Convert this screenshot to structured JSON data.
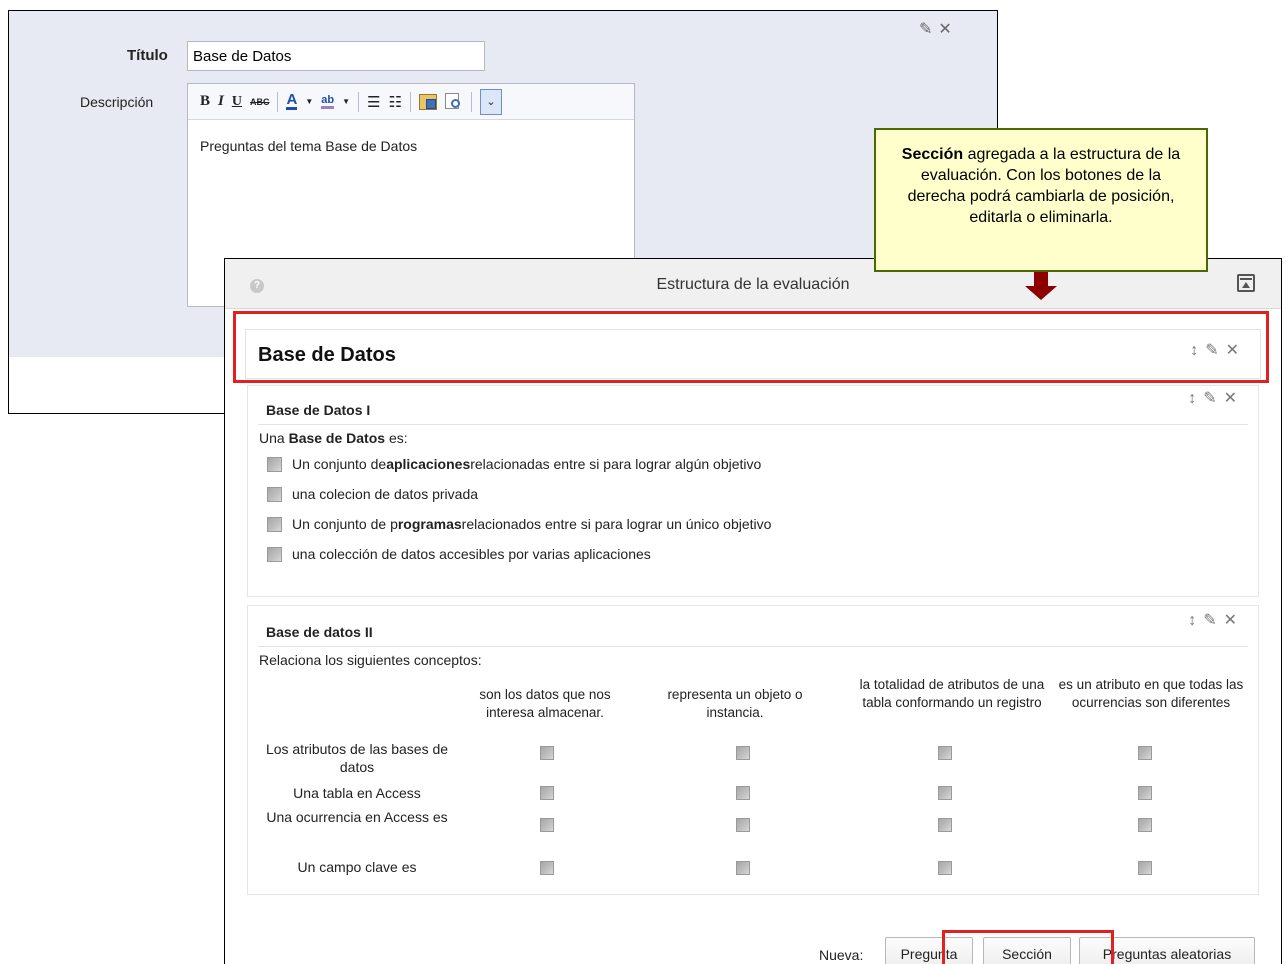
{
  "back_form": {
    "title_label": "Título",
    "title_value": "Base de Datos",
    "description_label": "Descripción",
    "description_text": "Preguntas del tema Base de Datos",
    "toolbar_icons": [
      "bold-icon",
      "italic-icon",
      "underline-icon",
      "strikethrough-icon",
      "font-color-icon",
      "highlight-color-icon",
      "bulleted-list-icon",
      "numbered-list-icon",
      "paste-word-icon",
      "find-icon",
      "more-icon"
    ],
    "toolbar_text": {
      "bold": "B",
      "italic": "I",
      "underline": "U",
      "strike": "ABC",
      "font_color": "A",
      "highlight": "ab"
    }
  },
  "callout": {
    "bold": "Sección",
    "text": " agregada a la estructura de la evaluación. Con los botones de la derecha podrá cambiarla de posición, editarla o eliminarla."
  },
  "main": {
    "title": "Estructura de la evaluación",
    "section": {
      "title": "Base de Datos"
    },
    "q1": {
      "title": "Base de Datos I",
      "prompt_prefix": "Una ",
      "prompt_bold": "Base de Datos",
      "prompt_suffix": " es:",
      "options": [
        {
          "pre": "Un conjunto de ",
          "bold": "aplicaciones",
          "post": " relacionadas entre si para lograr algún objetivo"
        },
        {
          "pre": "una colecion de datos privada",
          "bold": "",
          "post": ""
        },
        {
          "pre": "Un conjunto de p",
          "bold": "rogramas",
          "post": " relacionados entre si para lograr un único objetivo"
        },
        {
          "pre": "una colección de datos accesibles por varias aplicaciones",
          "bold": "",
          "post": ""
        }
      ]
    },
    "q2": {
      "title": "Base de datos II",
      "prompt": "Relaciona los siguientes conceptos:",
      "columns": [
        "son los datos que nos interesa almacenar.",
        "representa un objeto o instancia.",
        "la totalidad de atributos de una tabla conformando un registro",
        "es un atributo en que todas las ocurrencias son diferentes"
      ],
      "rows": [
        "Los atributos de las bases de datos",
        "Una tabla en Access",
        "Una ocurrencia en Access es",
        "Un campo clave es"
      ]
    },
    "bottom": {
      "nueva_label": "Nueva:",
      "btn_pregunta": "Pregunta",
      "btn_seccion": "Sección",
      "btn_aleatorias": "Preguntas aleatorias"
    }
  },
  "icons": {
    "move": "↕",
    "edit": "✎",
    "delete": "✕"
  },
  "colors": {
    "highlight_red": "#e0211f",
    "callout_bg": "#ffffcc",
    "arrow": "#8b0000",
    "form_bg": "#e7eaf3"
  }
}
